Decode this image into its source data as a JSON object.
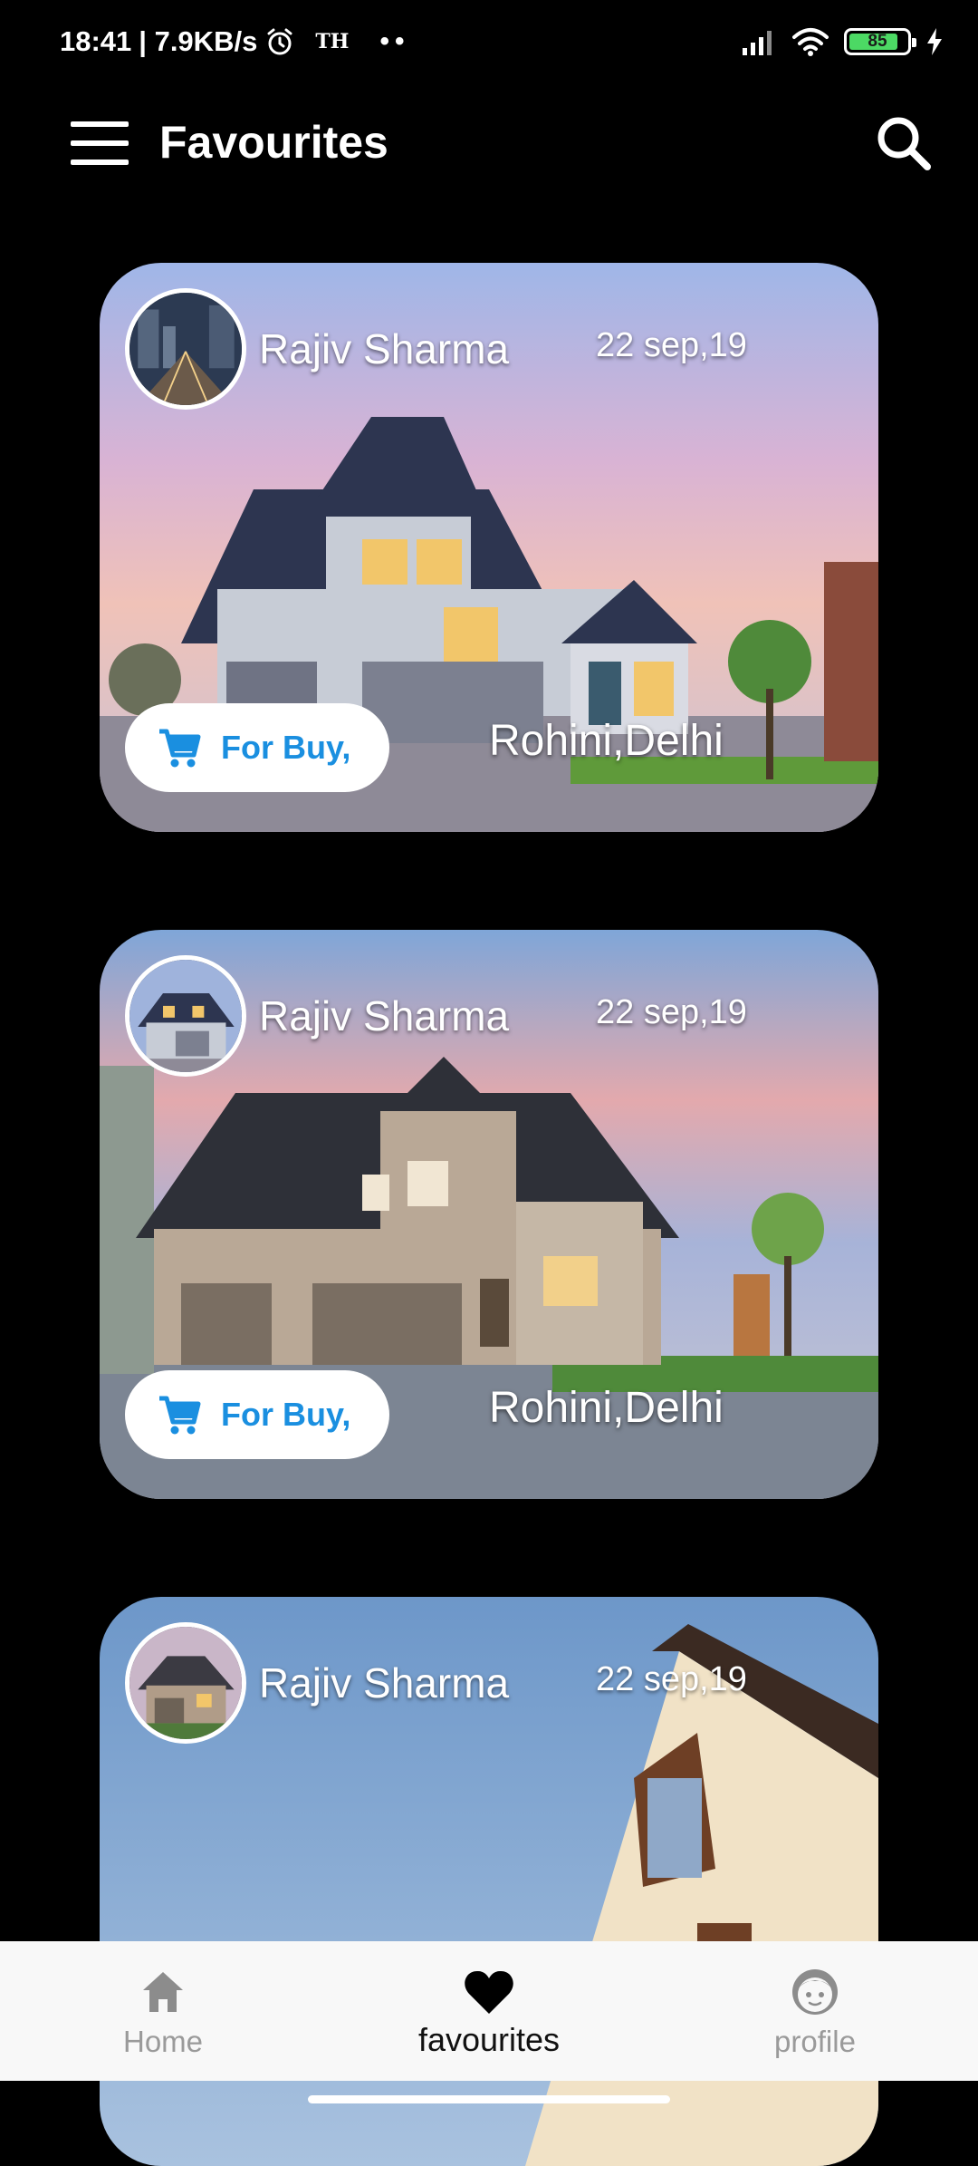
{
  "status_bar": {
    "time": "18:41",
    "network_speed": "| 7.9KB/s",
    "carrier_label": "TH",
    "more_dots": "••",
    "battery_percent": "85",
    "battery_level": 0.85
  },
  "header": {
    "title": "Favourites"
  },
  "listings": [
    {
      "owner_name": "Rajiv Sharma",
      "date": "22 sep,19",
      "tag_label": "For Buy,",
      "location": "Rohini,Delhi"
    },
    {
      "owner_name": "Rajiv Sharma",
      "date": "22 sep,19",
      "tag_label": "For Buy,",
      "location": "Rohini,Delhi"
    },
    {
      "owner_name": "Rajiv Sharma",
      "date": "22 sep,19"
    }
  ],
  "bottom_nav": {
    "items": [
      {
        "label": "Home",
        "icon": "home-icon",
        "active": false
      },
      {
        "label": "favourites",
        "icon": "heart-icon",
        "active": true
      },
      {
        "label": "profile",
        "icon": "face-icon",
        "active": false
      }
    ]
  },
  "colors": {
    "accent_blue": "#1a8fe0",
    "nav_background": "#f8f8f8",
    "battery_green": "#4cd964"
  }
}
